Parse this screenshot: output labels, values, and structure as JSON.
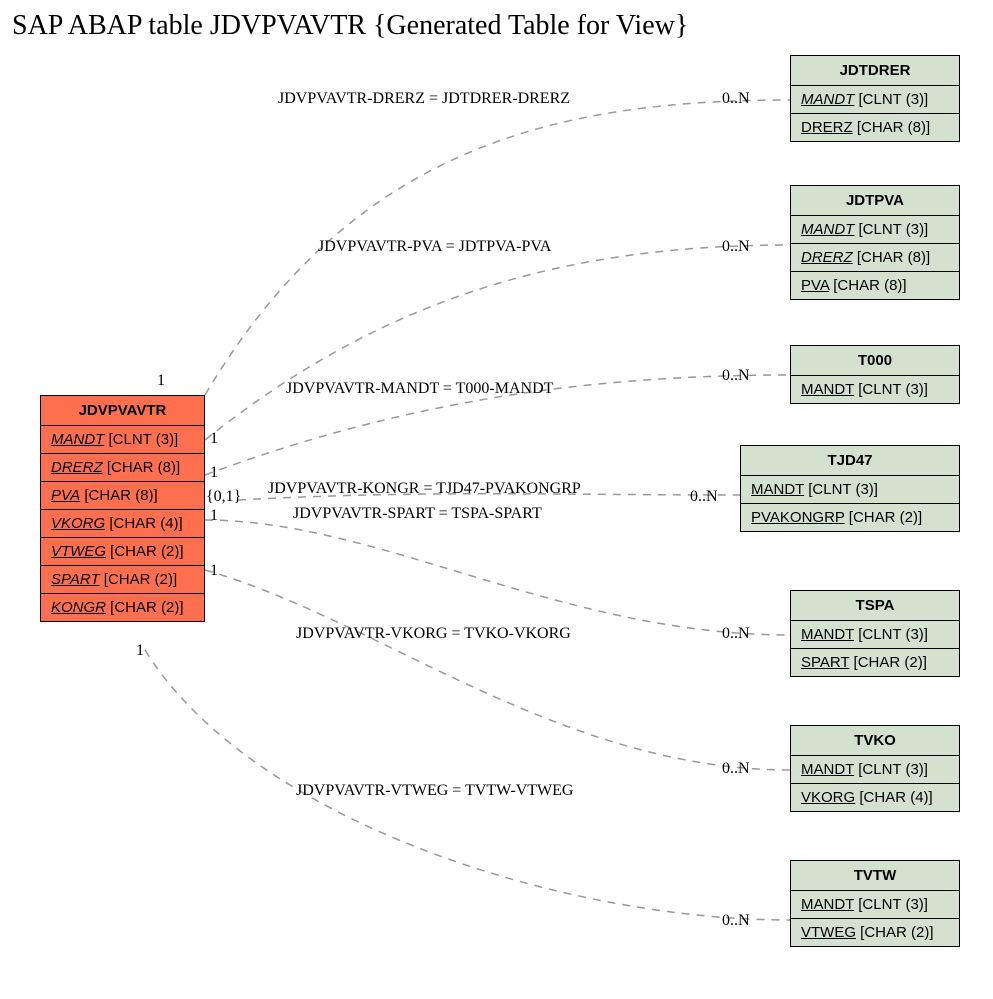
{
  "title": "SAP ABAP table JDVPVAVTR {Generated Table for View}",
  "main": {
    "name": "JDVPVAVTR",
    "fields": {
      "f0": {
        "k": "MANDT",
        "t": " [CLNT (3)]"
      },
      "f1": {
        "k": "DRERZ",
        "t": " [CHAR (8)]"
      },
      "f2": {
        "k": "PVA",
        "t": " [CHAR (8)]"
      },
      "f3": {
        "k": "VKORG",
        "t": " [CHAR (4)]"
      },
      "f4": {
        "k": "VTWEG",
        "t": " [CHAR (2)]"
      },
      "f5": {
        "k": "SPART",
        "t": " [CHAR (2)]"
      },
      "f6": {
        "k": "KONGR",
        "t": " [CHAR (2)]"
      }
    }
  },
  "rel": {
    "jdtdrer": {
      "name": "JDTDRER",
      "f0": {
        "k": "MANDT",
        "t": " [CLNT (3)]"
      },
      "f1": {
        "k": "DRERZ",
        "t": " [CHAR (8)]"
      }
    },
    "jdtpva": {
      "name": "JDTPVA",
      "f0": {
        "k": "MANDT",
        "t": " [CLNT (3)]"
      },
      "f1": {
        "k": "DRERZ",
        "t": " [CHAR (8)]"
      },
      "f2": {
        "k": "PVA",
        "t": " [CHAR (8)]"
      }
    },
    "t000": {
      "name": "T000",
      "f0": {
        "k": "MANDT",
        "t": " [CLNT (3)]"
      }
    },
    "tjd47": {
      "name": "TJD47",
      "f0": {
        "k": "MANDT",
        "t": " [CLNT (3)]"
      },
      "f1": {
        "k": "PVAKONGRP",
        "t": " [CHAR (2)]"
      }
    },
    "tspa": {
      "name": "TSPA",
      "f0": {
        "k": "MANDT",
        "t": " [CLNT (3)]"
      },
      "f1": {
        "k": "SPART",
        "t": " [CHAR (2)]"
      }
    },
    "tvko": {
      "name": "TVKO",
      "f0": {
        "k": "MANDT",
        "t": " [CLNT (3)]"
      },
      "f1": {
        "k": "VKORG",
        "t": " [CHAR (4)]"
      }
    },
    "tvtw": {
      "name": "TVTW",
      "f0": {
        "k": "MANDT",
        "t": " [CLNT (3)]"
      },
      "f1": {
        "k": "VTWEG",
        "t": " [CHAR (2)]"
      }
    }
  },
  "edges": {
    "e0": "JDVPVAVTR-DRERZ = JDTDRER-DRERZ",
    "e1": "JDVPVAVTR-PVA = JDTPVA-PVA",
    "e2": "JDVPVAVTR-MANDT = T000-MANDT",
    "e3": "JDVPVAVTR-KONGR = TJD47-PVAKONGRP",
    "e4": "JDVPVAVTR-SPART = TSPA-SPART",
    "e5": "JDVPVAVTR-VKORG = TVKO-VKORG",
    "e6": "JDVPVAVTR-VTWEG = TVTW-VTWEG"
  },
  "card": {
    "one": "1",
    "zeroone": "{0,1}",
    "zn": "0..N"
  }
}
